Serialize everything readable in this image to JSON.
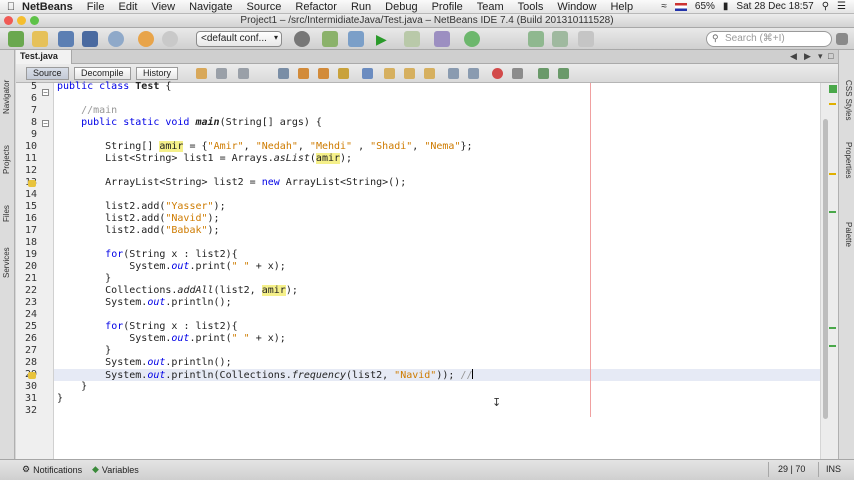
{
  "menubar": {
    "app_name": "NetBeans",
    "items": [
      "File",
      "Edit",
      "View",
      "Navigate",
      "Source",
      "Refactor",
      "Run",
      "Debug",
      "Profile",
      "Team",
      "Tools",
      "Window",
      "Help"
    ],
    "battery": "65%",
    "clock": "Sat 28 Dec  18:57"
  },
  "window": {
    "title": "Project1 – /src/IntermidiateJava/Test.java – NetBeans IDE 7.4 (Build 201310111528)"
  },
  "toolbar": {
    "config_value": "<default conf...",
    "search_placeholder": "Search (⌘+I)"
  },
  "left_tabs": [
    "Navigator",
    "Projects",
    "Files",
    "Services"
  ],
  "right_tabs": [
    "CSS Styles",
    "Properties",
    "Palette"
  ],
  "file_tab": {
    "label": "Test.java"
  },
  "editor_modes": {
    "source": "Source",
    "decompile": "Decompile",
    "history": "History"
  },
  "code": {
    "line_numbers": [
      "5",
      "6",
      "7",
      "8",
      "9",
      "10",
      "11",
      "12",
      "13",
      "14",
      "15",
      "16",
      "17",
      "18",
      "19",
      "20",
      "21",
      "22",
      "23",
      "24",
      "25",
      "26",
      "27",
      "28",
      "29",
      "30",
      "31",
      "32"
    ],
    "lines": [
      [
        {
          "t": "public class ",
          "c": "kw"
        },
        {
          "t": "Test",
          "c": "b"
        },
        {
          "t": " {",
          "c": ""
        }
      ],
      [],
      [
        {
          "t": "    //main",
          "c": "cmt"
        }
      ],
      [
        {
          "t": "    public static void ",
          "c": "kw"
        },
        {
          "t": "main",
          "c": "bi"
        },
        {
          "t": "(String[] args) {",
          "c": ""
        }
      ],
      [],
      [
        {
          "t": "        String[] ",
          "c": ""
        },
        {
          "t": "amir",
          "c": "hl"
        },
        {
          "t": " = {",
          "c": ""
        },
        {
          "t": "\"Amir\"",
          "c": "str"
        },
        {
          "t": ", ",
          "c": ""
        },
        {
          "t": "\"Nedah\"",
          "c": "str"
        },
        {
          "t": ", ",
          "c": ""
        },
        {
          "t": "\"Mehdi\"",
          "c": "str"
        },
        {
          "t": " , ",
          "c": ""
        },
        {
          "t": "\"Shadi\"",
          "c": "str"
        },
        {
          "t": ", ",
          "c": ""
        },
        {
          "t": "\"Nema\"",
          "c": "str"
        },
        {
          "t": "};",
          "c": ""
        }
      ],
      [
        {
          "t": "        List<String> ",
          "c": ""
        },
        {
          "t": "list1",
          "c": "u"
        },
        {
          "t": " = Arrays.",
          "c": ""
        },
        {
          "t": "asList",
          "c": "it"
        },
        {
          "t": "(",
          "c": ""
        },
        {
          "t": "amir",
          "c": "hl"
        },
        {
          "t": ");",
          "c": ""
        }
      ],
      [],
      [
        {
          "t": "        ArrayList<String> list2 = ",
          "c": ""
        },
        {
          "t": "new ",
          "c": "kw"
        },
        {
          "t": "ArrayList<String>",
          "c": "u"
        },
        {
          "t": "();",
          "c": ""
        }
      ],
      [],
      [
        {
          "t": "        list2.add(",
          "c": ""
        },
        {
          "t": "\"Yasser\"",
          "c": "str"
        },
        {
          "t": ");",
          "c": ""
        }
      ],
      [
        {
          "t": "        list2.add(",
          "c": ""
        },
        {
          "t": "\"Navid\"",
          "c": "str"
        },
        {
          "t": ");",
          "c": ""
        }
      ],
      [
        {
          "t": "        list2.add(",
          "c": ""
        },
        {
          "t": "\"Babak\"",
          "c": "str"
        },
        {
          "t": ");",
          "c": ""
        }
      ],
      [],
      [
        {
          "t": "        ",
          "c": ""
        },
        {
          "t": "for",
          "c": "kw"
        },
        {
          "t": "(String x : list2){",
          "c": ""
        }
      ],
      [
        {
          "t": "            System.",
          "c": ""
        },
        {
          "t": "out",
          "c": "it kw"
        },
        {
          "t": ".print(",
          "c": ""
        },
        {
          "t": "\" \"",
          "c": "str"
        },
        {
          "t": " + x);",
          "c": ""
        }
      ],
      [
        {
          "t": "        }",
          "c": ""
        }
      ],
      [
        {
          "t": "        Collections.",
          "c": ""
        },
        {
          "t": "addAll",
          "c": "it"
        },
        {
          "t": "(list2, ",
          "c": ""
        },
        {
          "t": "amir",
          "c": "hl"
        },
        {
          "t": ");",
          "c": ""
        }
      ],
      [
        {
          "t": "        System.",
          "c": ""
        },
        {
          "t": "out",
          "c": "it kw"
        },
        {
          "t": ".println();",
          "c": ""
        }
      ],
      [],
      [
        {
          "t": "        ",
          "c": ""
        },
        {
          "t": "for",
          "c": "kw"
        },
        {
          "t": "(String x : list2){",
          "c": ""
        }
      ],
      [
        {
          "t": "            System.",
          "c": ""
        },
        {
          "t": "out",
          "c": "it kw"
        },
        {
          "t": ".print(",
          "c": ""
        },
        {
          "t": "\" \"",
          "c": "str"
        },
        {
          "t": " + x);",
          "c": ""
        }
      ],
      [
        {
          "t": "        }",
          "c": ""
        }
      ],
      [
        {
          "t": "        System.",
          "c": ""
        },
        {
          "t": "out",
          "c": "it kw"
        },
        {
          "t": ".println();",
          "c": ""
        }
      ],
      [
        {
          "t": "        System.",
          "c": ""
        },
        {
          "t": "out",
          "c": "it kw"
        },
        {
          "t": ".println(Collections.",
          "c": ""
        },
        {
          "t": "frequency",
          "c": "it"
        },
        {
          "t": "(list2, ",
          "c": ""
        },
        {
          "t": "\"Navid\"",
          "c": "str"
        },
        {
          "t": ")); ",
          "c": ""
        },
        {
          "t": "//",
          "c": "cmt"
        },
        {
          "t": "|",
          "c": "caret"
        }
      ],
      [
        {
          "t": "    }",
          "c": ""
        }
      ],
      [
        {
          "t": "}",
          "c": ""
        }
      ],
      []
    ]
  },
  "status": {
    "notifications": "Notifications",
    "variables": "Variables",
    "position": "29 | 70",
    "mode": "INS"
  },
  "colors": {
    "keyword": "#0000e6",
    "string": "#ce7b00",
    "comment": "#969696",
    "highlight": "#f5f08a",
    "current_line": "#e6eaf5"
  }
}
